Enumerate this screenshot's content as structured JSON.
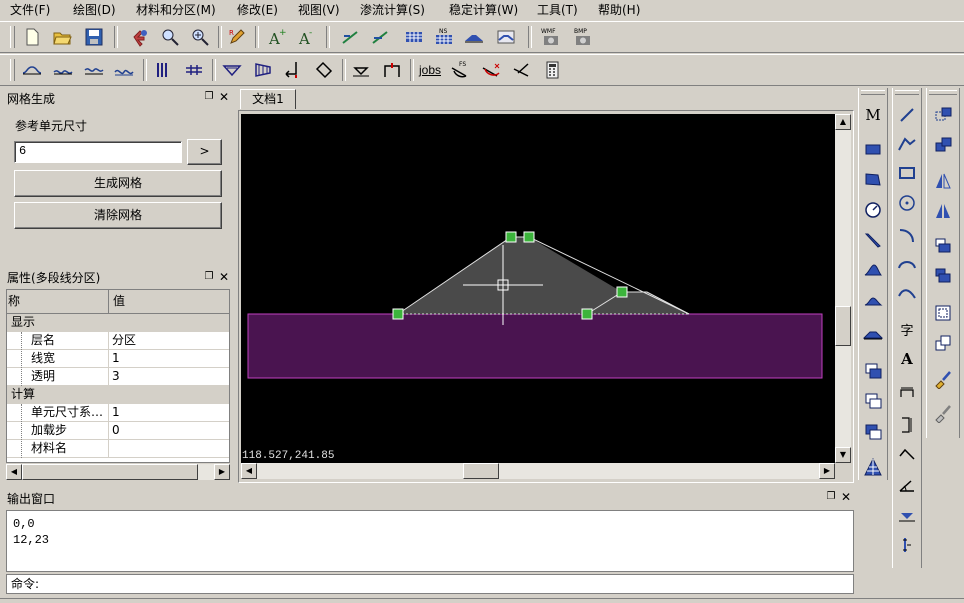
{
  "menu": [
    "文件(F)",
    "绘图(D)",
    "材料和分区(M)",
    "修改(E)",
    "视图(V)",
    "渗流计算(S)",
    "稳定计算(W)",
    "工具(T)",
    "帮助(H)"
  ],
  "toolbar1": {
    "icons": [
      "new-file-icon",
      "open-folder-icon",
      "save-icon",
      "pan-hand-icon",
      "zoom-window-icon",
      "zoom-in-icon",
      "edit-pencil-icon",
      "font-larger-icon",
      "font-smaller-icon",
      "line-edit-icon",
      "line-check-icon",
      "grid-table-icon",
      "ns-grid-icon",
      "slope-shape-icon",
      "slope-wave-icon",
      "wmf-camera-icon",
      "bmp-camera-icon"
    ],
    "font_up_label": "A",
    "font_down_label": "A",
    "ns_label": "NS",
    "wmf_label": "WMF",
    "bmp_label": "BMP"
  },
  "toolbar2": {
    "icons": [
      "curve-1-icon",
      "curve-2-icon",
      "curve-3-icon",
      "curve-4-icon",
      "vertical-lines-icon",
      "horizontal-lines-icon",
      "water-level-icon",
      "triangle-load-icon",
      "point-force-icon",
      "anchor-icon",
      "water-table-icon",
      "bracket-icon",
      "jobs-icon",
      "fs-slip-icon",
      "slip-circle-icon",
      "slip-plane-icon",
      "calculator-icon"
    ],
    "jobs_label": "jobs",
    "fs_label": "FS"
  },
  "mesh_panel": {
    "title": "网格生成",
    "ref_size_label": "参考单元尺寸",
    "ref_size_value": "6",
    "apply_label": ">",
    "generate_label": "生成网格",
    "clear_label": "清除网格"
  },
  "props_panel": {
    "title": "属性(多段线分区)",
    "col_name": "称",
    "col_value": "值",
    "rows": [
      {
        "type": "group",
        "name": "显示",
        "value": ""
      },
      {
        "type": "item",
        "name": "层名",
        "value": "分区"
      },
      {
        "type": "item",
        "name": "线宽",
        "value": "1"
      },
      {
        "type": "item",
        "name": "透明",
        "value": "3"
      },
      {
        "type": "group",
        "name": "计算",
        "value": ""
      },
      {
        "type": "item",
        "name": "单元尺寸系…",
        "value": "1"
      },
      {
        "type": "item",
        "name": "加载步",
        "value": "0"
      },
      {
        "type": "item",
        "name": "材料名",
        "value": ""
      }
    ]
  },
  "document": {
    "tab_label": "文档1",
    "coordinates": "118.527,241.85"
  },
  "output_panel": {
    "title": "输出窗口",
    "lines": [
      "0,0",
      "12,23"
    ],
    "command_label": "命令:"
  },
  "right_toolbar1": [
    "mtext-icon",
    "rectangle-icon",
    "polygon-icon",
    "dial-icon",
    "diagonal-shape-icon",
    "slope-fill-icon",
    "slope-fill-2-icon",
    "trapezoid-icon",
    "layer-copy-icon",
    "layer-stack-icon",
    "layer-stack-2-icon",
    "grid-triangle-icon"
  ],
  "right_toolbar1_text": "M",
  "right_toolbar2": [
    "line-icon",
    "polyline-icon",
    "rectangle-draw-icon",
    "circle-icon",
    "arc-icon",
    "arc-2-icon",
    "curve-icon",
    "text-icon",
    "text-a-icon",
    "dim-horizontal-icon",
    "dim-vertical-icon",
    "dim-angle-icon",
    "dim-angle-2-icon",
    "dim-triangle-icon",
    "dim-vertical-2-icon"
  ],
  "right_toolbar2_text": {
    "zi": "字",
    "a": "A"
  },
  "right_toolbar3": [
    "move-copy-icon",
    "copy-icon",
    "mirror-icon",
    "mirror-2-icon",
    "stretch-icon",
    "stretch-2-icon",
    "scale-icon",
    "scale-2-icon",
    "brush-icon",
    "eraser-brush-icon"
  ],
  "colors": {
    "canvas_bg": "#000000",
    "zone_fill": "#4a1450",
    "zone_stroke": "#c040c0",
    "dam_fill": "#4a4a4a",
    "handle": "#3cb43c"
  }
}
